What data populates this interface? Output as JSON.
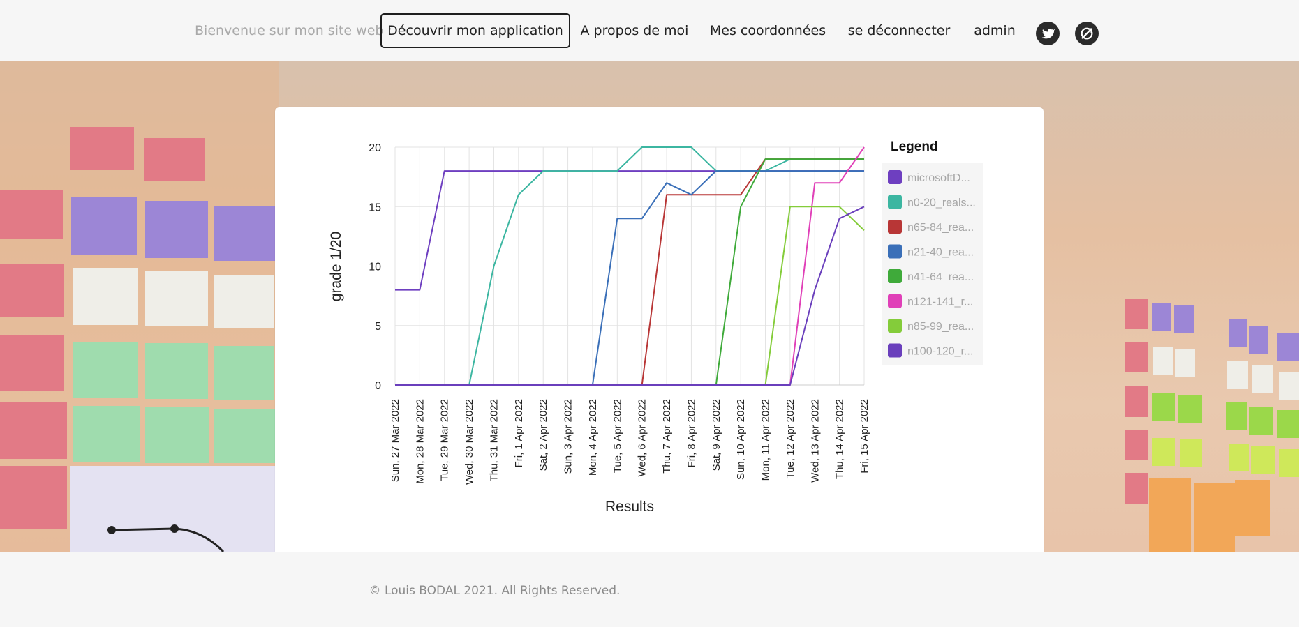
{
  "header": {
    "welcome": "Bienvenue sur mon site web :",
    "nav": [
      {
        "label": "Découvrir mon application",
        "active": true
      },
      {
        "label": "A propos de moi",
        "active": false
      },
      {
        "label": "Mes coordonnées",
        "active": false
      },
      {
        "label": "se déconnecter",
        "active": false
      },
      {
        "label": "admin",
        "active": false
      }
    ],
    "social": [
      {
        "icon": "twitter-icon"
      },
      {
        "icon": "link-icon"
      }
    ]
  },
  "footer": {
    "copyright": "© Louis BODAL 2021. All Rights Reserved."
  },
  "chart_data": {
    "type": "line",
    "xlabel": "Results",
    "ylabel": "grade 1/20",
    "ylim": [
      0,
      20
    ],
    "yticks": [
      0,
      5,
      10,
      15,
      20
    ],
    "grid": true,
    "legend_title": "Legend",
    "legend_position": "right",
    "categories": [
      "Sun, 27 Mar 2022",
      "Mon, 28 Mar 2022",
      "Tue, 29 Mar 2022",
      "Wed, 30 Mar 2022",
      "Thu, 31 Mar 2022",
      "Fri, 1 Apr 2022",
      "Sat, 2 Apr 2022",
      "Sun, 3 Apr 2022",
      "Mon, 4 Apr 2022",
      "Tue, 5 Apr 2022",
      "Wed, 6 Apr 2022",
      "Thu, 7 Apr 2022",
      "Fri, 8 Apr 2022",
      "Sat, 9 Apr 2022",
      "Sun, 10 Apr 2022",
      "Mon, 11 Apr 2022",
      "Tue, 12 Apr 2022",
      "Wed, 13 Apr 2022",
      "Thu, 14 Apr 2022",
      "Fri, 15 Apr 2022"
    ],
    "series": [
      {
        "name": "microsoftD...",
        "color": "#6e3fc0",
        "values": [
          8,
          8,
          18,
          18,
          18,
          18,
          18,
          18,
          18,
          18,
          18,
          18,
          18,
          18,
          18,
          18,
          18,
          18,
          18,
          18
        ]
      },
      {
        "name": "n0-20_reals...",
        "color": "#3cb6a1",
        "values": [
          0,
          0,
          0,
          0,
          10,
          16,
          18,
          18,
          18,
          18,
          20,
          20,
          20,
          18,
          18,
          18,
          19,
          19,
          19,
          19
        ]
      },
      {
        "name": "n65-84_rea...",
        "color": "#b83636",
        "values": [
          0,
          0,
          0,
          0,
          0,
          0,
          0,
          0,
          0,
          0,
          0,
          16,
          16,
          16,
          16,
          19,
          19,
          19,
          19,
          19
        ]
      },
      {
        "name": "n21-40_rea...",
        "color": "#3a6fb8",
        "values": [
          0,
          0,
          0,
          0,
          0,
          0,
          0,
          0,
          0,
          14,
          14,
          17,
          16,
          18,
          18,
          18,
          18,
          18,
          18,
          18
        ]
      },
      {
        "name": "n41-64_rea...",
        "color": "#3faa3a",
        "values": [
          0,
          0,
          0,
          0,
          0,
          0,
          0,
          0,
          0,
          0,
          0,
          0,
          0,
          0,
          15,
          19,
          19,
          19,
          19,
          19
        ]
      },
      {
        "name": "n121-141_r...",
        "color": "#e040b8",
        "values": [
          0,
          0,
          0,
          0,
          0,
          0,
          0,
          0,
          0,
          0,
          0,
          0,
          0,
          0,
          0,
          0,
          0,
          17,
          17,
          20
        ]
      },
      {
        "name": "n85-99_rea...",
        "color": "#84cc3a",
        "values": [
          0,
          0,
          0,
          0,
          0,
          0,
          0,
          0,
          0,
          0,
          0,
          0,
          0,
          0,
          0,
          0,
          15,
          15,
          15,
          13
        ]
      },
      {
        "name": "n100-120_r...",
        "color": "#6a3fbc",
        "values": [
          0,
          0,
          0,
          0,
          0,
          0,
          0,
          0,
          0,
          0,
          0,
          0,
          0,
          0,
          0,
          0,
          0,
          8,
          14,
          15
        ]
      }
    ]
  }
}
